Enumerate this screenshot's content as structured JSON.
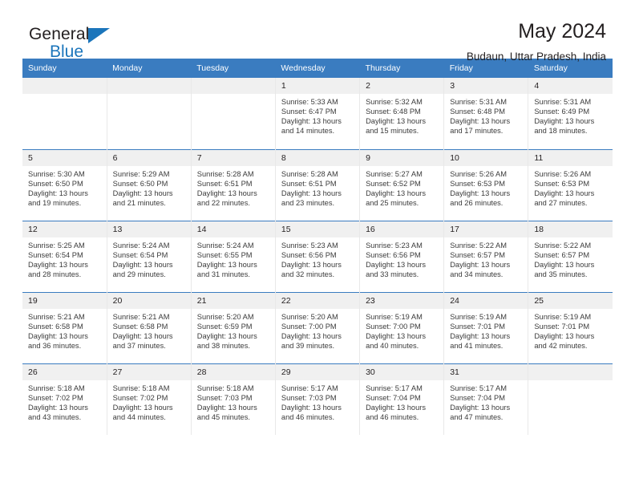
{
  "brand": {
    "word1": "General",
    "word2": "Blue",
    "flag_icon": "triangle-flag-icon",
    "accent_color": "#1b75bb"
  },
  "header": {
    "title": "May 2024",
    "subtitle": "Budaun, Uttar Pradesh, India"
  },
  "theme": {
    "header_blue": "#3a7cc0",
    "daynum_band": "#f0f0f0"
  },
  "weekday_headers": [
    "Sunday",
    "Monday",
    "Tuesday",
    "Wednesday",
    "Thursday",
    "Friday",
    "Saturday"
  ],
  "labels": {
    "sunrise_prefix": "Sunrise:",
    "sunset_prefix": "Sunset:",
    "daylight_prefix": "Daylight:"
  },
  "weeks": [
    [
      {
        "day": "",
        "empty": true
      },
      {
        "day": "",
        "empty": true
      },
      {
        "day": "",
        "empty": true
      },
      {
        "day": "1",
        "sunrise": "Sunrise: 5:33 AM",
        "sunset": "Sunset: 6:47 PM",
        "daylight1": "Daylight: 13 hours",
        "daylight2": "and 14 minutes."
      },
      {
        "day": "2",
        "sunrise": "Sunrise: 5:32 AM",
        "sunset": "Sunset: 6:48 PM",
        "daylight1": "Daylight: 13 hours",
        "daylight2": "and 15 minutes."
      },
      {
        "day": "3",
        "sunrise": "Sunrise: 5:31 AM",
        "sunset": "Sunset: 6:48 PM",
        "daylight1": "Daylight: 13 hours",
        "daylight2": "and 17 minutes."
      },
      {
        "day": "4",
        "sunrise": "Sunrise: 5:31 AM",
        "sunset": "Sunset: 6:49 PM",
        "daylight1": "Daylight: 13 hours",
        "daylight2": "and 18 minutes."
      }
    ],
    [
      {
        "day": "5",
        "sunrise": "Sunrise: 5:30 AM",
        "sunset": "Sunset: 6:50 PM",
        "daylight1": "Daylight: 13 hours",
        "daylight2": "and 19 minutes."
      },
      {
        "day": "6",
        "sunrise": "Sunrise: 5:29 AM",
        "sunset": "Sunset: 6:50 PM",
        "daylight1": "Daylight: 13 hours",
        "daylight2": "and 21 minutes."
      },
      {
        "day": "7",
        "sunrise": "Sunrise: 5:28 AM",
        "sunset": "Sunset: 6:51 PM",
        "daylight1": "Daylight: 13 hours",
        "daylight2": "and 22 minutes."
      },
      {
        "day": "8",
        "sunrise": "Sunrise: 5:28 AM",
        "sunset": "Sunset: 6:51 PM",
        "daylight1": "Daylight: 13 hours",
        "daylight2": "and 23 minutes."
      },
      {
        "day": "9",
        "sunrise": "Sunrise: 5:27 AM",
        "sunset": "Sunset: 6:52 PM",
        "daylight1": "Daylight: 13 hours",
        "daylight2": "and 25 minutes."
      },
      {
        "day": "10",
        "sunrise": "Sunrise: 5:26 AM",
        "sunset": "Sunset: 6:53 PM",
        "daylight1": "Daylight: 13 hours",
        "daylight2": "and 26 minutes."
      },
      {
        "day": "11",
        "sunrise": "Sunrise: 5:26 AM",
        "sunset": "Sunset: 6:53 PM",
        "daylight1": "Daylight: 13 hours",
        "daylight2": "and 27 minutes."
      }
    ],
    [
      {
        "day": "12",
        "sunrise": "Sunrise: 5:25 AM",
        "sunset": "Sunset: 6:54 PM",
        "daylight1": "Daylight: 13 hours",
        "daylight2": "and 28 minutes."
      },
      {
        "day": "13",
        "sunrise": "Sunrise: 5:24 AM",
        "sunset": "Sunset: 6:54 PM",
        "daylight1": "Daylight: 13 hours",
        "daylight2": "and 29 minutes."
      },
      {
        "day": "14",
        "sunrise": "Sunrise: 5:24 AM",
        "sunset": "Sunset: 6:55 PM",
        "daylight1": "Daylight: 13 hours",
        "daylight2": "and 31 minutes."
      },
      {
        "day": "15",
        "sunrise": "Sunrise: 5:23 AM",
        "sunset": "Sunset: 6:56 PM",
        "daylight1": "Daylight: 13 hours",
        "daylight2": "and 32 minutes."
      },
      {
        "day": "16",
        "sunrise": "Sunrise: 5:23 AM",
        "sunset": "Sunset: 6:56 PM",
        "daylight1": "Daylight: 13 hours",
        "daylight2": "and 33 minutes."
      },
      {
        "day": "17",
        "sunrise": "Sunrise: 5:22 AM",
        "sunset": "Sunset: 6:57 PM",
        "daylight1": "Daylight: 13 hours",
        "daylight2": "and 34 minutes."
      },
      {
        "day": "18",
        "sunrise": "Sunrise: 5:22 AM",
        "sunset": "Sunset: 6:57 PM",
        "daylight1": "Daylight: 13 hours",
        "daylight2": "and 35 minutes."
      }
    ],
    [
      {
        "day": "19",
        "sunrise": "Sunrise: 5:21 AM",
        "sunset": "Sunset: 6:58 PM",
        "daylight1": "Daylight: 13 hours",
        "daylight2": "and 36 minutes."
      },
      {
        "day": "20",
        "sunrise": "Sunrise: 5:21 AM",
        "sunset": "Sunset: 6:58 PM",
        "daylight1": "Daylight: 13 hours",
        "daylight2": "and 37 minutes."
      },
      {
        "day": "21",
        "sunrise": "Sunrise: 5:20 AM",
        "sunset": "Sunset: 6:59 PM",
        "daylight1": "Daylight: 13 hours",
        "daylight2": "and 38 minutes."
      },
      {
        "day": "22",
        "sunrise": "Sunrise: 5:20 AM",
        "sunset": "Sunset: 7:00 PM",
        "daylight1": "Daylight: 13 hours",
        "daylight2": "and 39 minutes."
      },
      {
        "day": "23",
        "sunrise": "Sunrise: 5:19 AM",
        "sunset": "Sunset: 7:00 PM",
        "daylight1": "Daylight: 13 hours",
        "daylight2": "and 40 minutes."
      },
      {
        "day": "24",
        "sunrise": "Sunrise: 5:19 AM",
        "sunset": "Sunset: 7:01 PM",
        "daylight1": "Daylight: 13 hours",
        "daylight2": "and 41 minutes."
      },
      {
        "day": "25",
        "sunrise": "Sunrise: 5:19 AM",
        "sunset": "Sunset: 7:01 PM",
        "daylight1": "Daylight: 13 hours",
        "daylight2": "and 42 minutes."
      }
    ],
    [
      {
        "day": "26",
        "sunrise": "Sunrise: 5:18 AM",
        "sunset": "Sunset: 7:02 PM",
        "daylight1": "Daylight: 13 hours",
        "daylight2": "and 43 minutes."
      },
      {
        "day": "27",
        "sunrise": "Sunrise: 5:18 AM",
        "sunset": "Sunset: 7:02 PM",
        "daylight1": "Daylight: 13 hours",
        "daylight2": "and 44 minutes."
      },
      {
        "day": "28",
        "sunrise": "Sunrise: 5:18 AM",
        "sunset": "Sunset: 7:03 PM",
        "daylight1": "Daylight: 13 hours",
        "daylight2": "and 45 minutes."
      },
      {
        "day": "29",
        "sunrise": "Sunrise: 5:17 AM",
        "sunset": "Sunset: 7:03 PM",
        "daylight1": "Daylight: 13 hours",
        "daylight2": "and 46 minutes."
      },
      {
        "day": "30",
        "sunrise": "Sunrise: 5:17 AM",
        "sunset": "Sunset: 7:04 PM",
        "daylight1": "Daylight: 13 hours",
        "daylight2": "and 46 minutes."
      },
      {
        "day": "31",
        "sunrise": "Sunrise: 5:17 AM",
        "sunset": "Sunset: 7:04 PM",
        "daylight1": "Daylight: 13 hours",
        "daylight2": "and 47 minutes."
      },
      {
        "day": "",
        "empty": true
      }
    ]
  ]
}
